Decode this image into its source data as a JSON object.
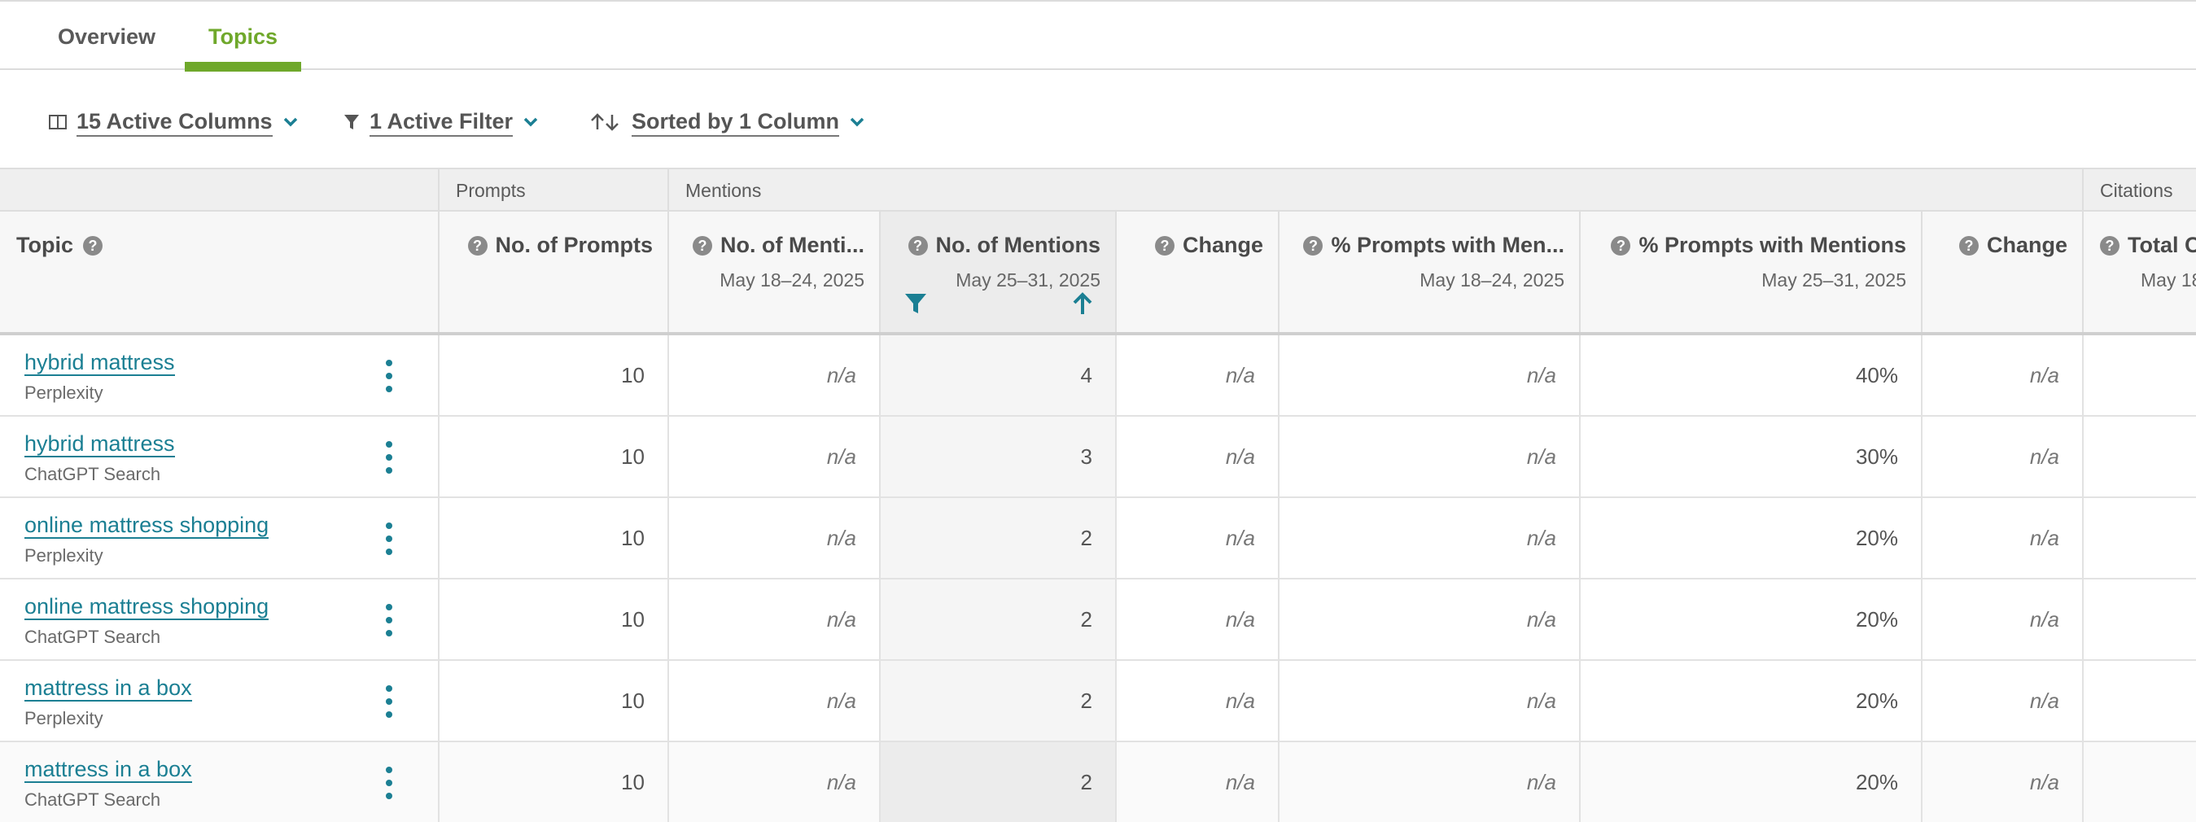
{
  "tabs": [
    {
      "label": "Overview",
      "active": false
    },
    {
      "label": "Topics",
      "active": true
    }
  ],
  "toolbar": {
    "columns_label": "15 Active Columns",
    "filter_label": "1 Active Filter",
    "sort_label": "Sorted by 1 Column"
  },
  "column_groups": {
    "prompts": "Prompts",
    "mentions": "Mentions",
    "citations": "Citations"
  },
  "headers": {
    "topic": "Topic",
    "prompts": "No. of Prompts",
    "mentions_prev": "No. of Menti...",
    "mentions_prev_date": "May 18–24, 2025",
    "mentions_cur": "No. of Mentions",
    "mentions_cur_date": "May 25–31, 2025",
    "change": "Change",
    "pct_prev": "% Prompts with Men...",
    "pct_prev_date": "May 18–24, 2025",
    "pct_cur": "% Prompts with Mentions",
    "pct_cur_date": "May 25–31, 2025",
    "change2": "Change",
    "citations_total": "Total C",
    "citations_date": "May 18–2"
  },
  "rows": [
    {
      "topic": "hybrid mattress",
      "source": "Perplexity",
      "prompts": "10",
      "mentions_prev": "n/a",
      "mentions_cur": "4",
      "change": "n/a",
      "pct_prev": "n/a",
      "pct_cur": "40%",
      "change2": "n/a"
    },
    {
      "topic": "hybrid mattress",
      "source": "ChatGPT Search",
      "prompts": "10",
      "mentions_prev": "n/a",
      "mentions_cur": "3",
      "change": "n/a",
      "pct_prev": "n/a",
      "pct_cur": "30%",
      "change2": "n/a"
    },
    {
      "topic": "online mattress shopping",
      "source": "Perplexity",
      "prompts": "10",
      "mentions_prev": "n/a",
      "mentions_cur": "2",
      "change": "n/a",
      "pct_prev": "n/a",
      "pct_cur": "20%",
      "change2": "n/a"
    },
    {
      "topic": "online mattress shopping",
      "source": "ChatGPT Search",
      "prompts": "10",
      "mentions_prev": "n/a",
      "mentions_cur": "2",
      "change": "n/a",
      "pct_prev": "n/a",
      "pct_cur": "20%",
      "change2": "n/a"
    },
    {
      "topic": "mattress in a box",
      "source": "Perplexity",
      "prompts": "10",
      "mentions_prev": "n/a",
      "mentions_cur": "2",
      "change": "n/a",
      "pct_prev": "n/a",
      "pct_cur": "20%",
      "change2": "n/a"
    },
    {
      "topic": "mattress in a box",
      "source": "ChatGPT Search",
      "prompts": "10",
      "mentions_prev": "n/a",
      "mentions_cur": "2",
      "change": "n/a",
      "pct_prev": "n/a",
      "pct_cur": "20%",
      "change2": "n/a"
    }
  ],
  "colors": {
    "accent_green": "#6fa82b",
    "link_teal": "#1b7f93"
  },
  "icons": {
    "columns": "columns-icon",
    "filter": "filter-icon",
    "sort": "sort-icon",
    "chevron": "chevron-down-icon",
    "help": "help-icon",
    "kebab": "more-vertical-icon",
    "sort_up": "arrow-up-icon"
  }
}
